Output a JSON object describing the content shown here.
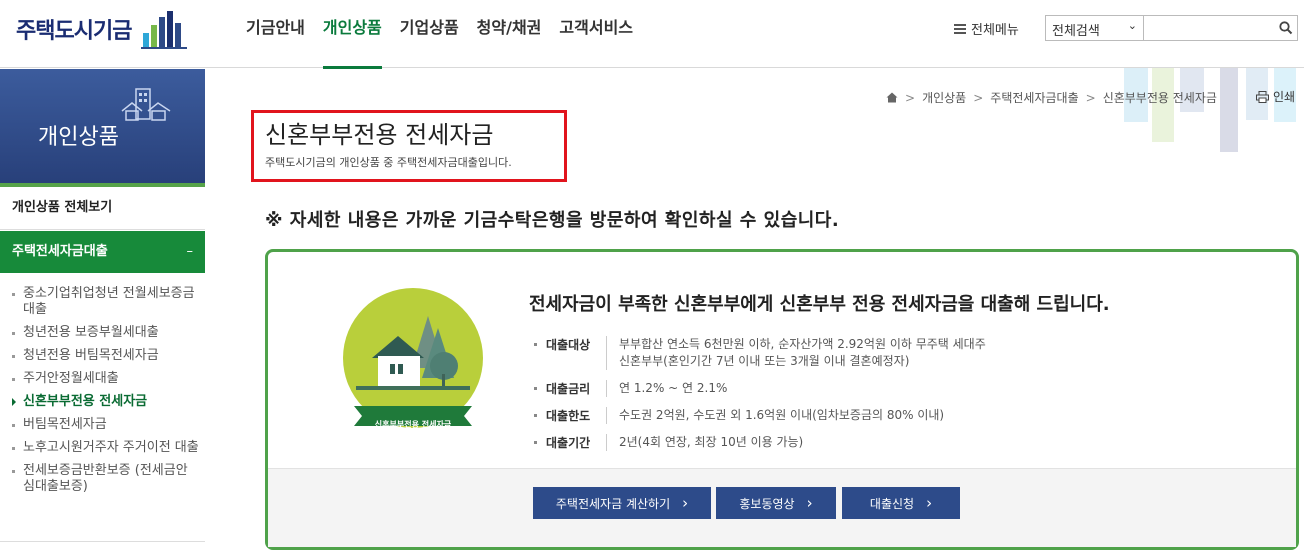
{
  "header": {
    "logo_text": "주택도시기금",
    "nav": [
      "기금안내",
      "개인상품",
      "기업상품",
      "청약/채권",
      "고객서비스"
    ],
    "nav_active_index": 1,
    "all_menu": "전체메뉴",
    "search_select": "전체검색",
    "search_placeholder": ""
  },
  "sidebar": {
    "banner_title": "개인상품",
    "all_view": "개인상품 전체보기",
    "category": "주택전세자금대출",
    "category_toggle": "–",
    "items": [
      "중소기업취업청년 전월세보증금대출",
      "청년전용 보증부월세대출",
      "청년전용 버팀목전세자금",
      "주거안정월세대출",
      "신혼부부전용 전세자금",
      "버팀목전세자금",
      "노후고시원거주자 주거이전 대출",
      "전세보증금반환보증 (전세금안심대출보증)"
    ],
    "active_index": 4
  },
  "breadcrumb": [
    "개인상품",
    "주택전세자금대출",
    "신혼부부전용 전세자금"
  ],
  "print_label": "인쇄",
  "page": {
    "title": "신혼부부전용 전세자금",
    "subtitle": "주택도시기금의 개인상품 중 주택전세자금대출입니다.",
    "notice": "※ 자세한 내용은 가까운 기금수탁은행을 방문하여 확인하실 수 있습니다."
  },
  "product": {
    "badge_text": "신혼부부전용 전세자금",
    "heading": "전세자금이 부족한 신혼부부에게 신혼부부 전용 전세자금을 대출해 드립니다.",
    "rows": [
      {
        "label": "대출대상",
        "line1": "부부합산 연소득 6천만원 이하, 순자산가액 2.92억원 이하 무주택 세대주",
        "line2": "신혼부부(혼인기간 7년 이내 또는 3개월 이내 결혼예정자)"
      },
      {
        "label": "대출금리",
        "line1": "연 1.2% ~ 연 2.1%",
        "line2": ""
      },
      {
        "label": "대출한도",
        "line1": "수도권 2억원, 수도권 외 1.6억원 이내(임차보증금의 80% 이내)",
        "line2": ""
      },
      {
        "label": "대출기간",
        "line1": "2년(4회 연장, 최장 10년 이용 가능)",
        "line2": ""
      }
    ],
    "buttons": [
      "주택전세자금 계산하기",
      "홍보동영상",
      "대출신청"
    ]
  },
  "colors": {
    "brand_green": "#178a3a",
    "brand_navy": "#2d4b8a",
    "highlight_red": "#e1141d"
  }
}
